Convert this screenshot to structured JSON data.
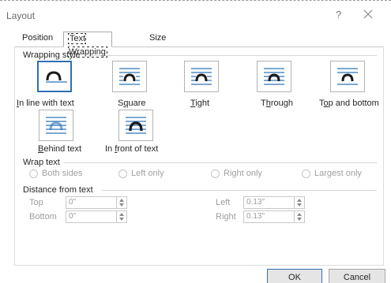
{
  "dialog": {
    "title": "Layout",
    "help": "?"
  },
  "tabs": [
    {
      "label": "Position"
    },
    {
      "label": "Text Wrapping"
    },
    {
      "label": "Size"
    }
  ],
  "wrapping_style": {
    "heading": "Wrapping style",
    "options": [
      {
        "pre": "",
        "key": "I",
        "post": "n line with text",
        "icon": "inline-with-text-icon",
        "selected": true
      },
      {
        "pre": "S",
        "key": "q",
        "post": "uare",
        "icon": "square-wrap-icon"
      },
      {
        "pre": "",
        "key": "T",
        "post": "ight",
        "icon": "tight-wrap-icon"
      },
      {
        "pre": "T",
        "key": "h",
        "post": "rough",
        "icon": "through-wrap-icon"
      },
      {
        "pre": "T",
        "key": "o",
        "post": "p and bottom",
        "icon": "top-and-bottom-icon"
      },
      {
        "pre": "",
        "key": "B",
        "post": "ehind text",
        "icon": "behind-text-icon"
      },
      {
        "pre": "In ",
        "key": "f",
        "post": "ront of text",
        "icon": "in-front-of-text-icon"
      }
    ]
  },
  "wrap_text": {
    "heading": "Wrap text",
    "options": [
      {
        "label": "Both sides"
      },
      {
        "label": "Left only"
      },
      {
        "label": "Right only"
      },
      {
        "label": "Largest only"
      }
    ]
  },
  "distance": {
    "heading": "Distance from text",
    "top": {
      "label": "Top",
      "value": "0\""
    },
    "bottom": {
      "label": "Bottom",
      "value": "0\""
    },
    "left": {
      "label": "Left",
      "value": "0.13\""
    },
    "right": {
      "label": "Right",
      "value": "0.13\""
    }
  },
  "buttons": {
    "ok": "OK",
    "cancel": "Cancel"
  },
  "colors": {
    "accent": "#2f6fb3",
    "icon_dark": "#1a1a1a",
    "icon_lines": "#2e75b6",
    "behind_icon": "#7ea7d4"
  }
}
